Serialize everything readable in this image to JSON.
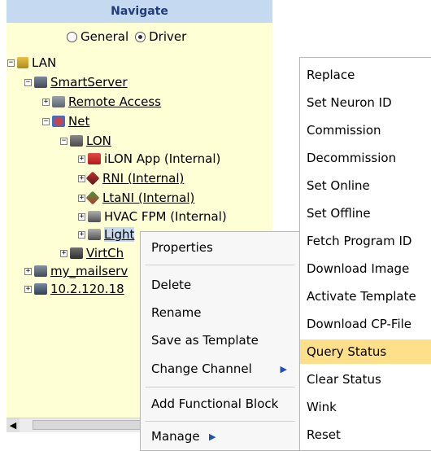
{
  "navigate": {
    "header": "Navigate",
    "modes": [
      {
        "label": "General",
        "checked": false
      },
      {
        "label": "Driver",
        "checked": true
      }
    ]
  },
  "tree": {
    "lan": "LAN",
    "smartserver": "SmartServer",
    "remote_access": "Remote Access",
    "net": "Net",
    "lon": "LON",
    "ilon_app": "iLON App (Internal)",
    "rni": "RNI (Internal)",
    "ltani": "LtaNI (Internal)",
    "hvac": "HVAC FPM (Internal)",
    "light": "Light",
    "virtch": "VirtCh",
    "mailserver": "my_mailserv",
    "ip": "10.2.120.18"
  },
  "context_menu": {
    "items": [
      "Properties",
      "Delete",
      "Rename",
      "Save as Template",
      "Change Channel",
      "Add Functional Block",
      "Manage"
    ]
  },
  "submenu": {
    "items": [
      "Replace",
      "Set Neuron ID",
      "Commission",
      "Decommission",
      "Set Online",
      "Set Offline",
      "Fetch Program ID",
      "Download Image",
      "Activate Template",
      "Download CP-File",
      "Query Status",
      "Clear Status",
      "Wink",
      "Reset"
    ],
    "highlighted": "Query Status"
  },
  "colors": {
    "header_bg": "#c5d9f1",
    "tree_bg": "#ffffd6",
    "highlight": "#ffe08a"
  }
}
